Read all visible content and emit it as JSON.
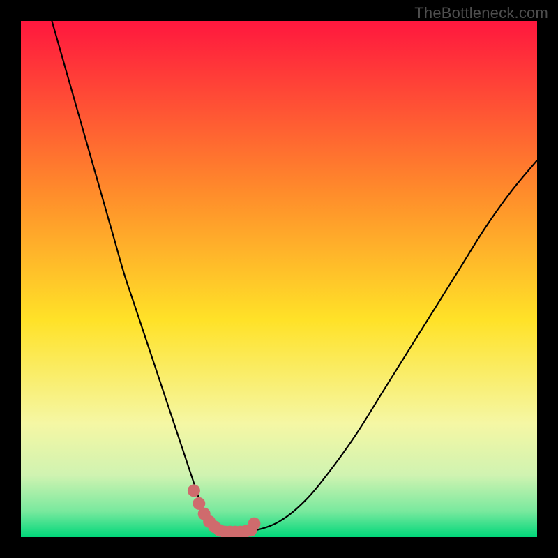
{
  "watermark": "TheBottleneck.com",
  "colors": {
    "frame": "#000000",
    "grad_top": "#ff173e",
    "grad_mid_upper": "#ff8b2b",
    "grad_mid": "#ffe228",
    "grad_low1": "#f5f7a4",
    "grad_low2": "#d0f3b1",
    "grad_low3": "#79e99e",
    "grad_bottom": "#00d77a",
    "curve": "#000000",
    "marker_fill": "#cf6b6d",
    "marker_stroke": "#cf6b6d"
  },
  "chart_data": {
    "type": "line",
    "title": "",
    "xlabel": "",
    "ylabel": "",
    "xlim": [
      0,
      100
    ],
    "ylim": [
      0,
      100
    ],
    "grid": false,
    "legend": false,
    "series": [
      {
        "name": "bottleneck-curve",
        "x": [
          6,
          8,
          10,
          12,
          14,
          16,
          18,
          20,
          22,
          24,
          26,
          28,
          30,
          31,
          32,
          33,
          34,
          35,
          36,
          37,
          38,
          39,
          40,
          42,
          45,
          50,
          55,
          60,
          65,
          70,
          75,
          80,
          85,
          90,
          95,
          100
        ],
        "y": [
          100,
          93,
          86,
          79,
          72,
          65,
          58,
          51,
          45,
          39,
          33,
          27,
          21,
          18,
          15,
          12,
          9,
          6,
          4,
          2.5,
          1.5,
          1,
          1,
          1,
          1.2,
          3,
          7,
          13,
          20,
          28,
          36,
          44,
          52,
          60,
          67,
          73
        ]
      }
    ],
    "markers": {
      "name": "highlighted-region",
      "x": [
        33.5,
        34.5,
        35.5,
        36.5,
        37.5,
        38.5,
        39.5,
        40.5,
        41.5,
        42.5,
        43.5,
        44.5,
        45.2
      ],
      "y": [
        9.0,
        6.5,
        4.5,
        3.0,
        2.0,
        1.3,
        1.0,
        1.0,
        1.0,
        1.0,
        1.1,
        1.3,
        2.6
      ],
      "radius": 9
    },
    "annotations": []
  }
}
